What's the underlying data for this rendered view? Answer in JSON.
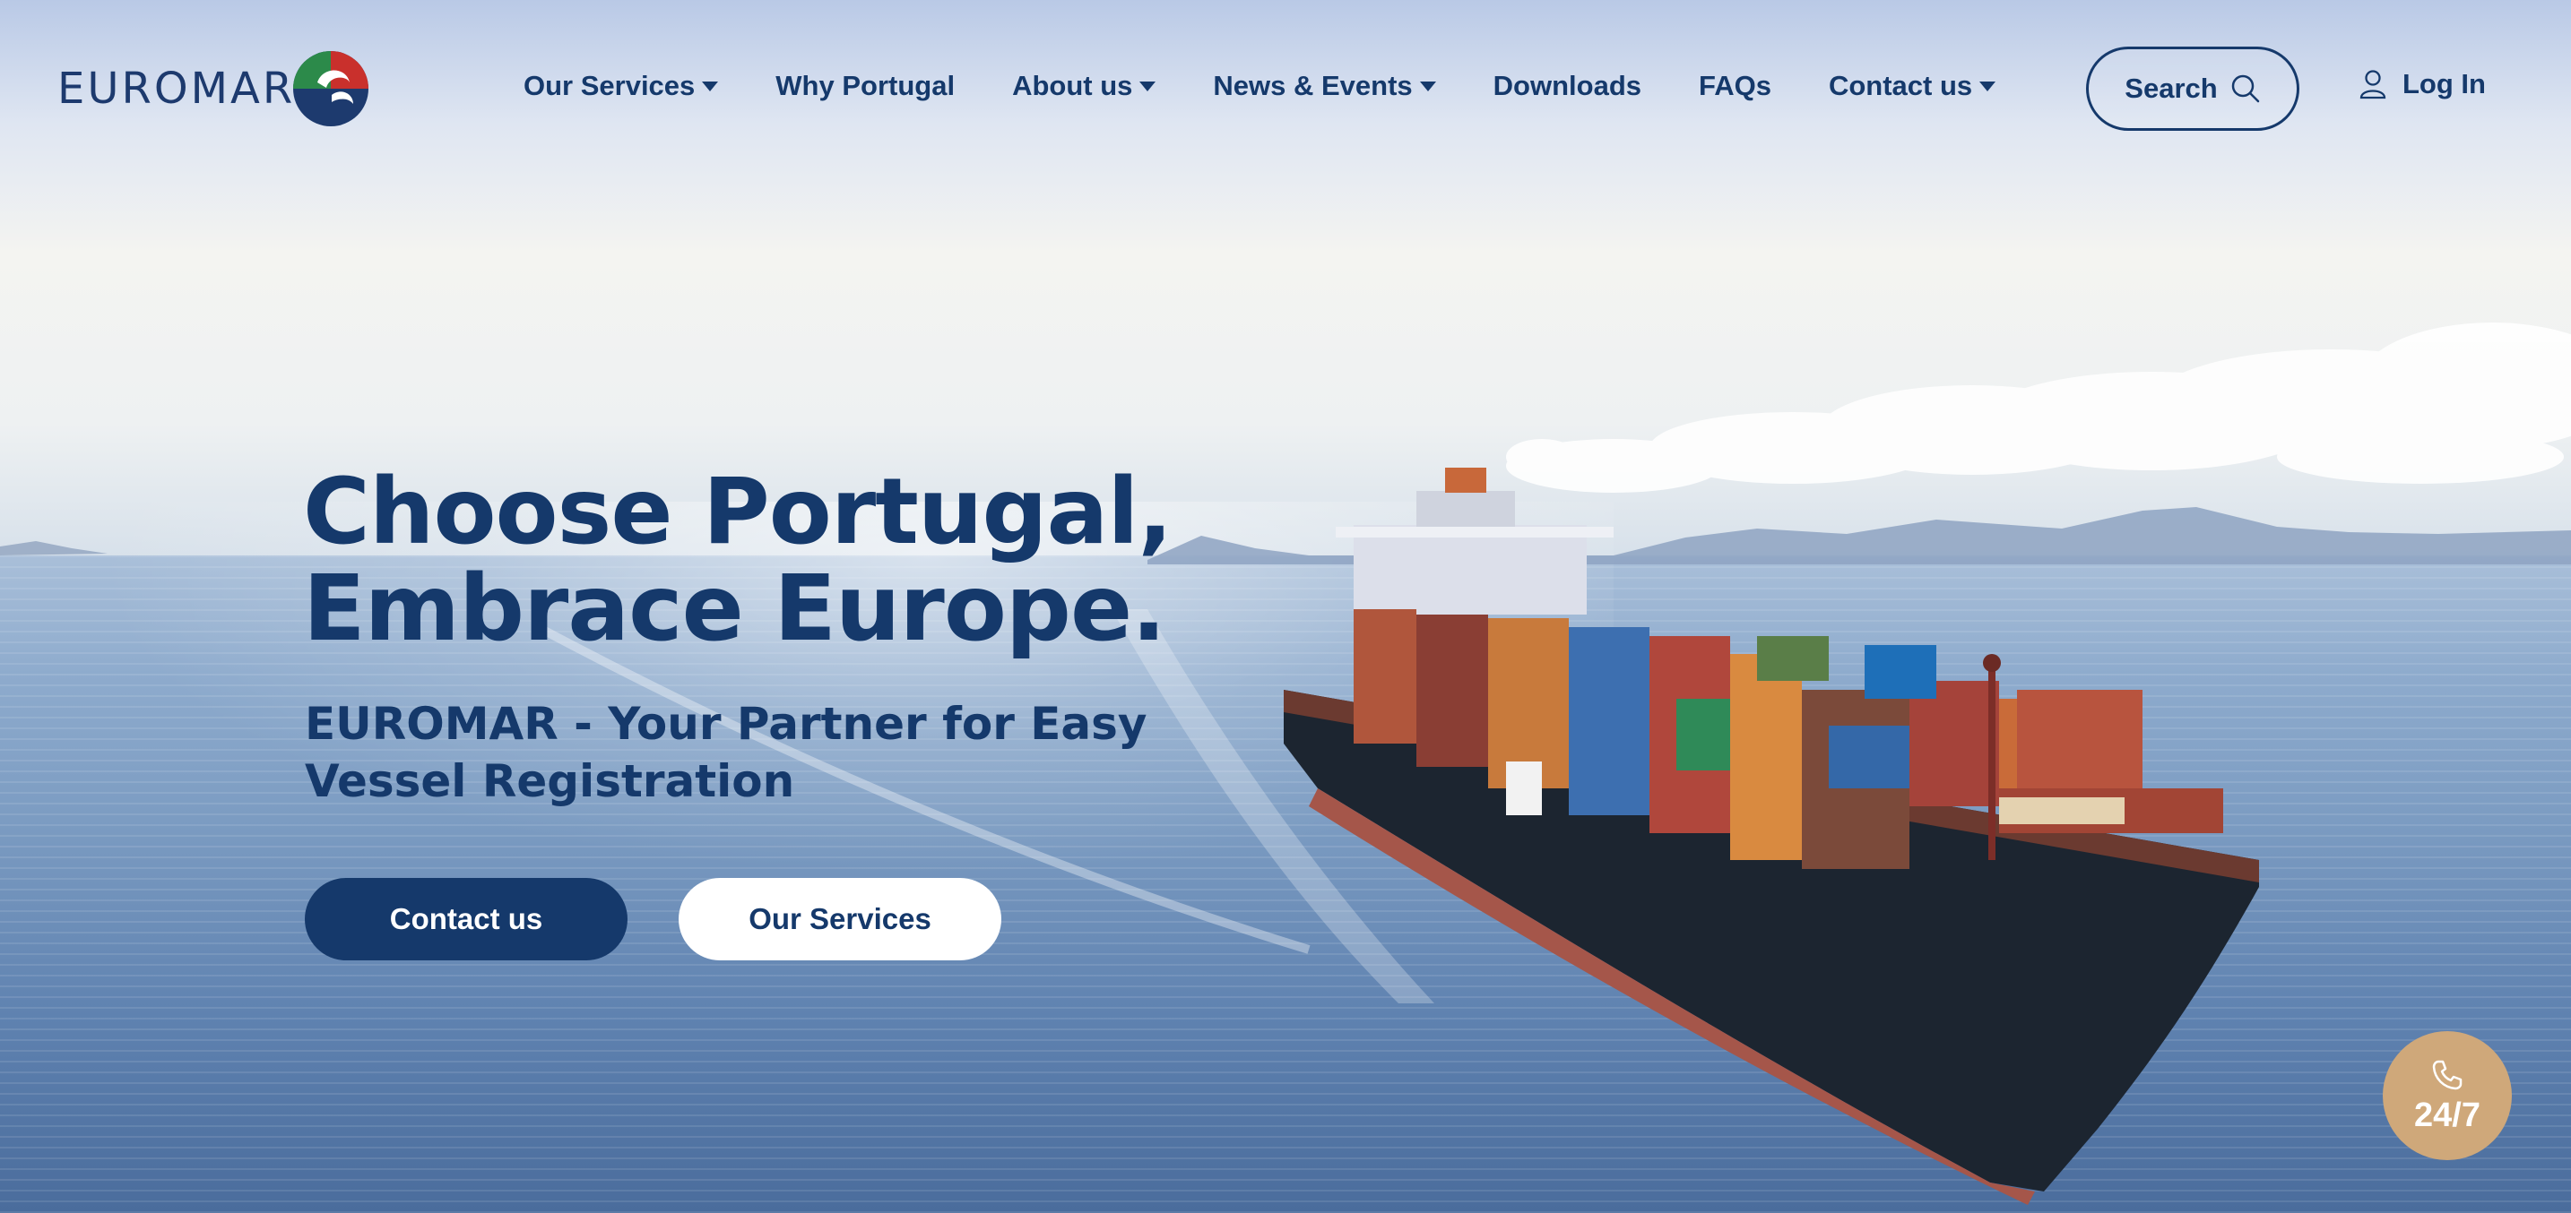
{
  "brand": {
    "name": "EUROMAR"
  },
  "nav": {
    "items": [
      {
        "label": "Our Services",
        "dropdown": true
      },
      {
        "label": "Why Portugal",
        "dropdown": false
      },
      {
        "label": "About us",
        "dropdown": true
      },
      {
        "label": "News & Events",
        "dropdown": true
      },
      {
        "label": "Downloads",
        "dropdown": false
      },
      {
        "label": "FAQs",
        "dropdown": false
      },
      {
        "label": "Contact us",
        "dropdown": true
      }
    ],
    "search_label": "Search",
    "login_label": "Log In"
  },
  "hero": {
    "title_line1": "Choose Portugal,",
    "title_line2": "Embrace Europe.",
    "subtitle_line1": "EUROMAR - Your Partner for Easy",
    "subtitle_line2": "Vessel Registration",
    "primary_button": "Contact us",
    "secondary_button": "Our Services"
  },
  "support_badge": {
    "label": "24/7",
    "icon": "phone-icon"
  },
  "colors": {
    "brand_navy": "#15396b",
    "support_gold": "#cfa87a",
    "white": "#ffffff"
  }
}
